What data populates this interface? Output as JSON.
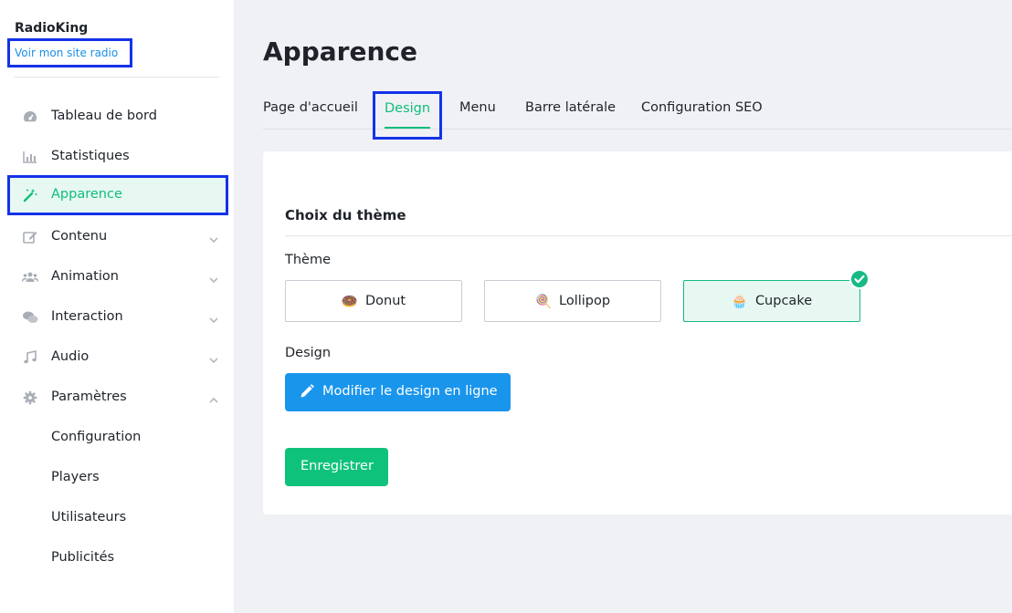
{
  "brand": "RadioKing",
  "site_link": "Voir mon site radio",
  "nav": {
    "items": [
      {
        "label": "Tableau de bord",
        "icon": "dashboard-gauge-icon"
      },
      {
        "label": "Statistiques",
        "icon": "bar-chart-icon"
      },
      {
        "label": "Apparence",
        "icon": "magic-wand-icon",
        "active": true
      },
      {
        "label": "Contenu",
        "icon": "edit-note-icon",
        "expandable": true
      },
      {
        "label": "Animation",
        "icon": "users-group-icon",
        "expandable": true
      },
      {
        "label": "Interaction",
        "icon": "chat-bubbles-icon",
        "expandable": true
      },
      {
        "label": "Audio",
        "icon": "music-note-icon",
        "expandable": true
      },
      {
        "label": "Paramètres",
        "icon": "gear-icon",
        "expandable": true,
        "expanded": true
      }
    ],
    "sub_items": [
      {
        "label": "Configuration"
      },
      {
        "label": "Players"
      },
      {
        "label": "Utilisateurs"
      },
      {
        "label": "Publicités"
      }
    ]
  },
  "page": {
    "title": "Apparence",
    "tabs": [
      {
        "label": "Page d'accueil"
      },
      {
        "label": "Design",
        "active": true
      },
      {
        "label": "Menu"
      },
      {
        "label": "Barre latérale"
      },
      {
        "label": "Configuration SEO"
      }
    ]
  },
  "card": {
    "section_title": "Choix du thème",
    "theme_label": "Thème",
    "themes": [
      {
        "label": "Donut",
        "emoji": "🍩"
      },
      {
        "label": "Lollipop",
        "emoji": "🍭"
      },
      {
        "label": "Cupcake",
        "emoji": "🧁",
        "selected": true
      }
    ],
    "design_label": "Design",
    "edit_button": "Modifier le design en ligne",
    "save_button": "Enregistrer"
  },
  "colors": {
    "accent_green": "#0fbd7a",
    "accent_blue": "#1a95ec",
    "highlight_border": "#1432e8",
    "sidebar_bg": "#ffffff",
    "page_bg": "#f0f1f5"
  }
}
